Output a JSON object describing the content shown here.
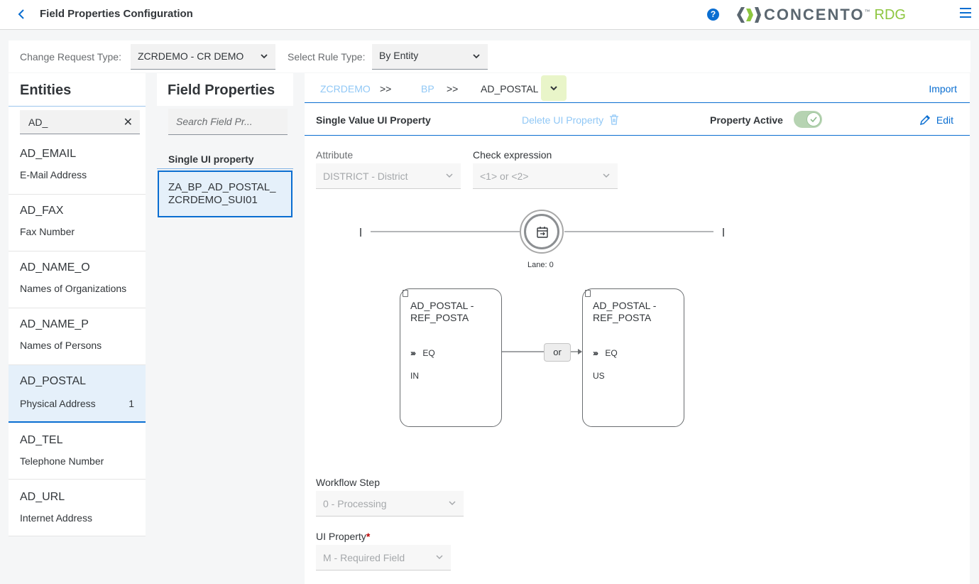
{
  "header": {
    "title": "Field Properties Configuration",
    "help_glyph": "?",
    "logo_word": "CONCENTO",
    "logo_tm": "™",
    "logo_rdg": "RDG"
  },
  "filters": {
    "change_request_label": "Change Request Type:",
    "change_request_value": "ZCRDEMO - CR DEMO",
    "rule_type_label": "Select Rule Type:",
    "rule_type_value": "By Entity"
  },
  "entities": {
    "title": "Entities",
    "search_value": "AD_",
    "items": [
      {
        "name": "AD_EMAIL",
        "desc": "E-Mail Address",
        "count": ""
      },
      {
        "name": "AD_FAX",
        "desc": "Fax Number",
        "count": ""
      },
      {
        "name": "AD_NAME_O",
        "desc": "Names of Organizations",
        "count": ""
      },
      {
        "name": "AD_NAME_P",
        "desc": "Names of Persons",
        "count": ""
      },
      {
        "name": "AD_POSTAL",
        "desc": "Physical Address",
        "count": "1"
      },
      {
        "name": "AD_TEL",
        "desc": "Telephone Number",
        "count": ""
      },
      {
        "name": "AD_URL",
        "desc": "Internet Address",
        "count": ""
      }
    ]
  },
  "field_properties": {
    "title": "Field Properties",
    "search_placeholder": "Search Field Pr...",
    "group_label": "Single UI property",
    "item_line1": "ZA_BP_AD_POSTAL_",
    "item_line2": "ZCRDEMO_SUI01"
  },
  "main": {
    "breadcrumb": {
      "c1": "ZCRDEMO",
      "sep1": ">>",
      "c2": "BP",
      "sep2": ">>",
      "c3": "AD_POSTAL"
    },
    "import_label": "Import",
    "property_title": "Single Value UI Property",
    "delete_label": "Delete UI Property",
    "active_label": "Property Active",
    "edit_label": "Edit",
    "attribute_label": "Attribute",
    "attribute_value": "DISTRICT - District",
    "check_label": "Check expression",
    "check_value": "<1> or <2>",
    "lane_label": "Lane: 0",
    "node1": {
      "line1": "AD_POSTAL -",
      "line2": "REF_POSTA",
      "op": "EQ",
      "val": "IN"
    },
    "node2": {
      "line1": "AD_POSTAL -",
      "line2": "REF_POSTA",
      "op": "EQ",
      "val": "US"
    },
    "or_label": "or",
    "workflow_label": "Workflow Step",
    "workflow_value": "0 - Processing",
    "ui_property_label": "UI Property",
    "ui_property_required": "*",
    "ui_property_value": "M - Required Field"
  },
  "colors": {
    "accent": "#0a6ed1",
    "brand_green": "#8dc63f",
    "selected_bg": "#e5f0fa"
  }
}
